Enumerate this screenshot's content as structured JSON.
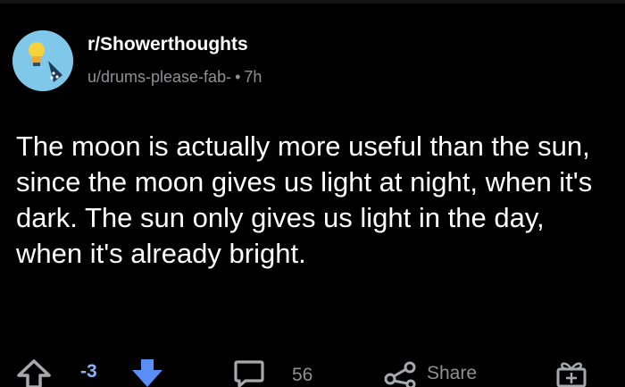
{
  "post": {
    "subreddit": "r/Showerthoughts",
    "author": "u/drums-please-fab-",
    "separator": "•",
    "age": "7h",
    "body": "The moon is actually more useful than the sun, since the moon gives us light at night, when it's dark. The sun only gives us light in the day, when it's already bright."
  },
  "actions": {
    "score": "-3",
    "comment_count": "56",
    "share_label": "Share"
  },
  "colors": {
    "background": "#000000",
    "text": "#ffffff",
    "muted": "#8e9092",
    "downvote_active": "#5b8df7",
    "avatar_bg": "#7fc8ea"
  },
  "icons": [
    "shower-lightbulb-avatar-icon",
    "upvote-arrow-icon",
    "downvote-arrow-icon",
    "comment-icon",
    "share-icon",
    "award-icon"
  ]
}
